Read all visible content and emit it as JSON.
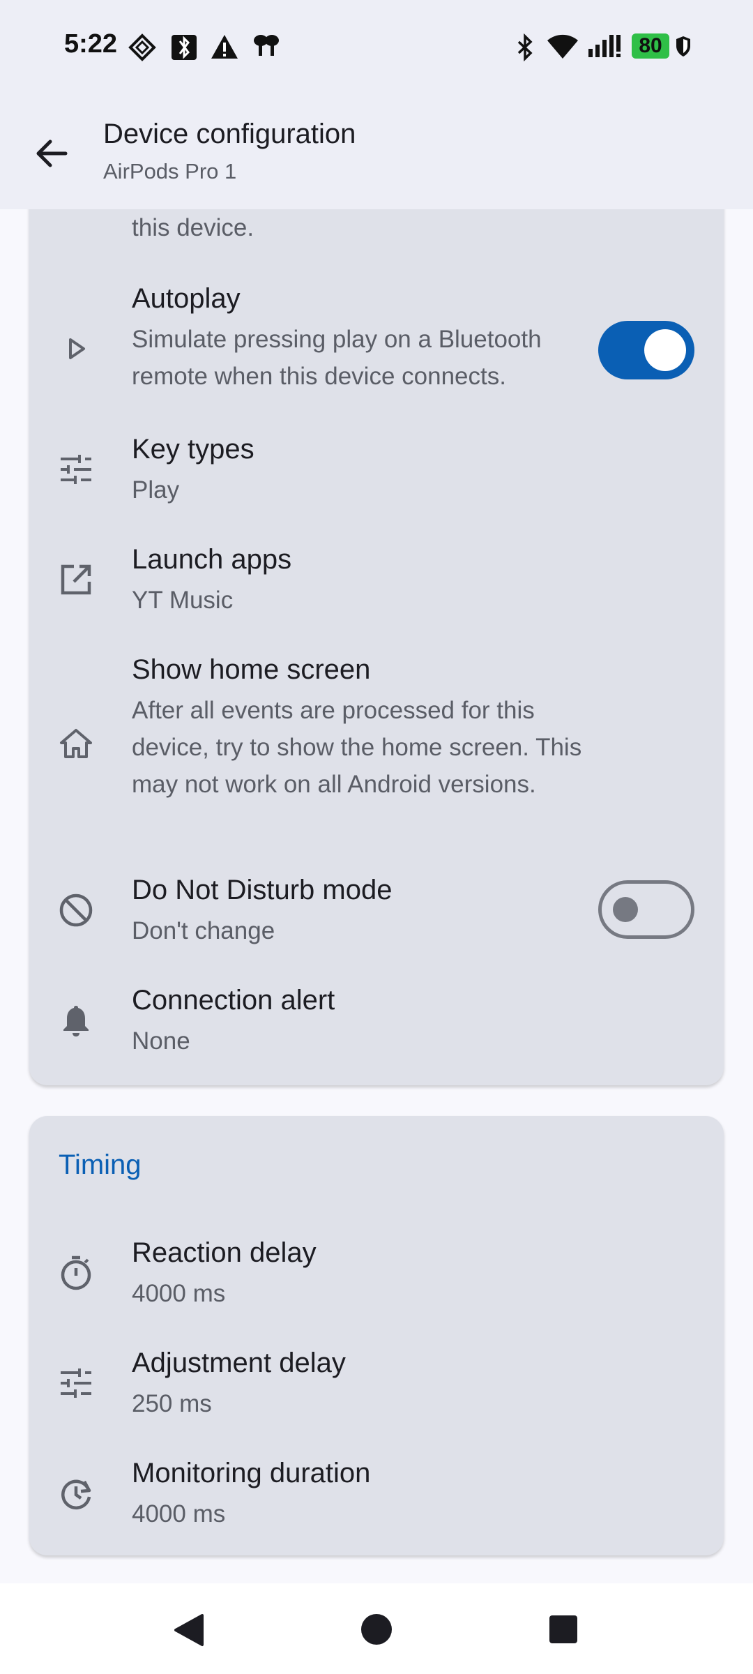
{
  "status_bar": {
    "time": "5:22",
    "battery": "80",
    "icons": [
      "app-icon",
      "bluetooth-box-icon",
      "warning-icon",
      "fan-icon",
      "bluetooth-icon",
      "wifi-icon",
      "signal-icon",
      "shield-icon"
    ]
  },
  "app_bar": {
    "title": "Device configuration",
    "subtitle": "AirPods Pro 1"
  },
  "settings": {
    "cut_off_text": "this device.",
    "autoplay": {
      "title": "Autoplay",
      "summary": "Simulate pressing play on a Bluetooth remote when this device connects.",
      "enabled": true,
      "icon": "play-icon"
    },
    "key_types": {
      "title": "Key types",
      "value": "Play",
      "icon": "tune-icon"
    },
    "launch_apps": {
      "title": "Launch apps",
      "value": "YT Music",
      "icon": "open-in-new-icon"
    },
    "show_home_screen": {
      "title": "Show home screen",
      "summary": "After all events are processed for this device, try to show the home screen. This may not work on all Android versions.",
      "enabled": false,
      "icon": "home-icon"
    },
    "dnd": {
      "title": "Do Not Disturb mode",
      "value": "Don't change",
      "icon": "block-icon"
    },
    "connection_alert": {
      "title": "Connection alert",
      "value": "None",
      "icon": "bell-icon"
    }
  },
  "timing": {
    "section_title": "Timing",
    "reaction_delay": {
      "title": "Reaction delay",
      "value": "4000 ms",
      "icon": "timer-icon"
    },
    "adjustment_delay": {
      "title": "Adjustment delay",
      "value": "250 ms",
      "icon": "tune-icon"
    },
    "monitoring_duration": {
      "title": "Monitoring duration",
      "value": "4000 ms",
      "icon": "history-icon"
    }
  },
  "colors": {
    "accent": "#0a5fb4",
    "card": "#dfe1e9",
    "app_bar": "#edeef6"
  },
  "nav_bar": [
    "back-nav-icon",
    "home-nav-icon",
    "recents-nav-icon"
  ]
}
